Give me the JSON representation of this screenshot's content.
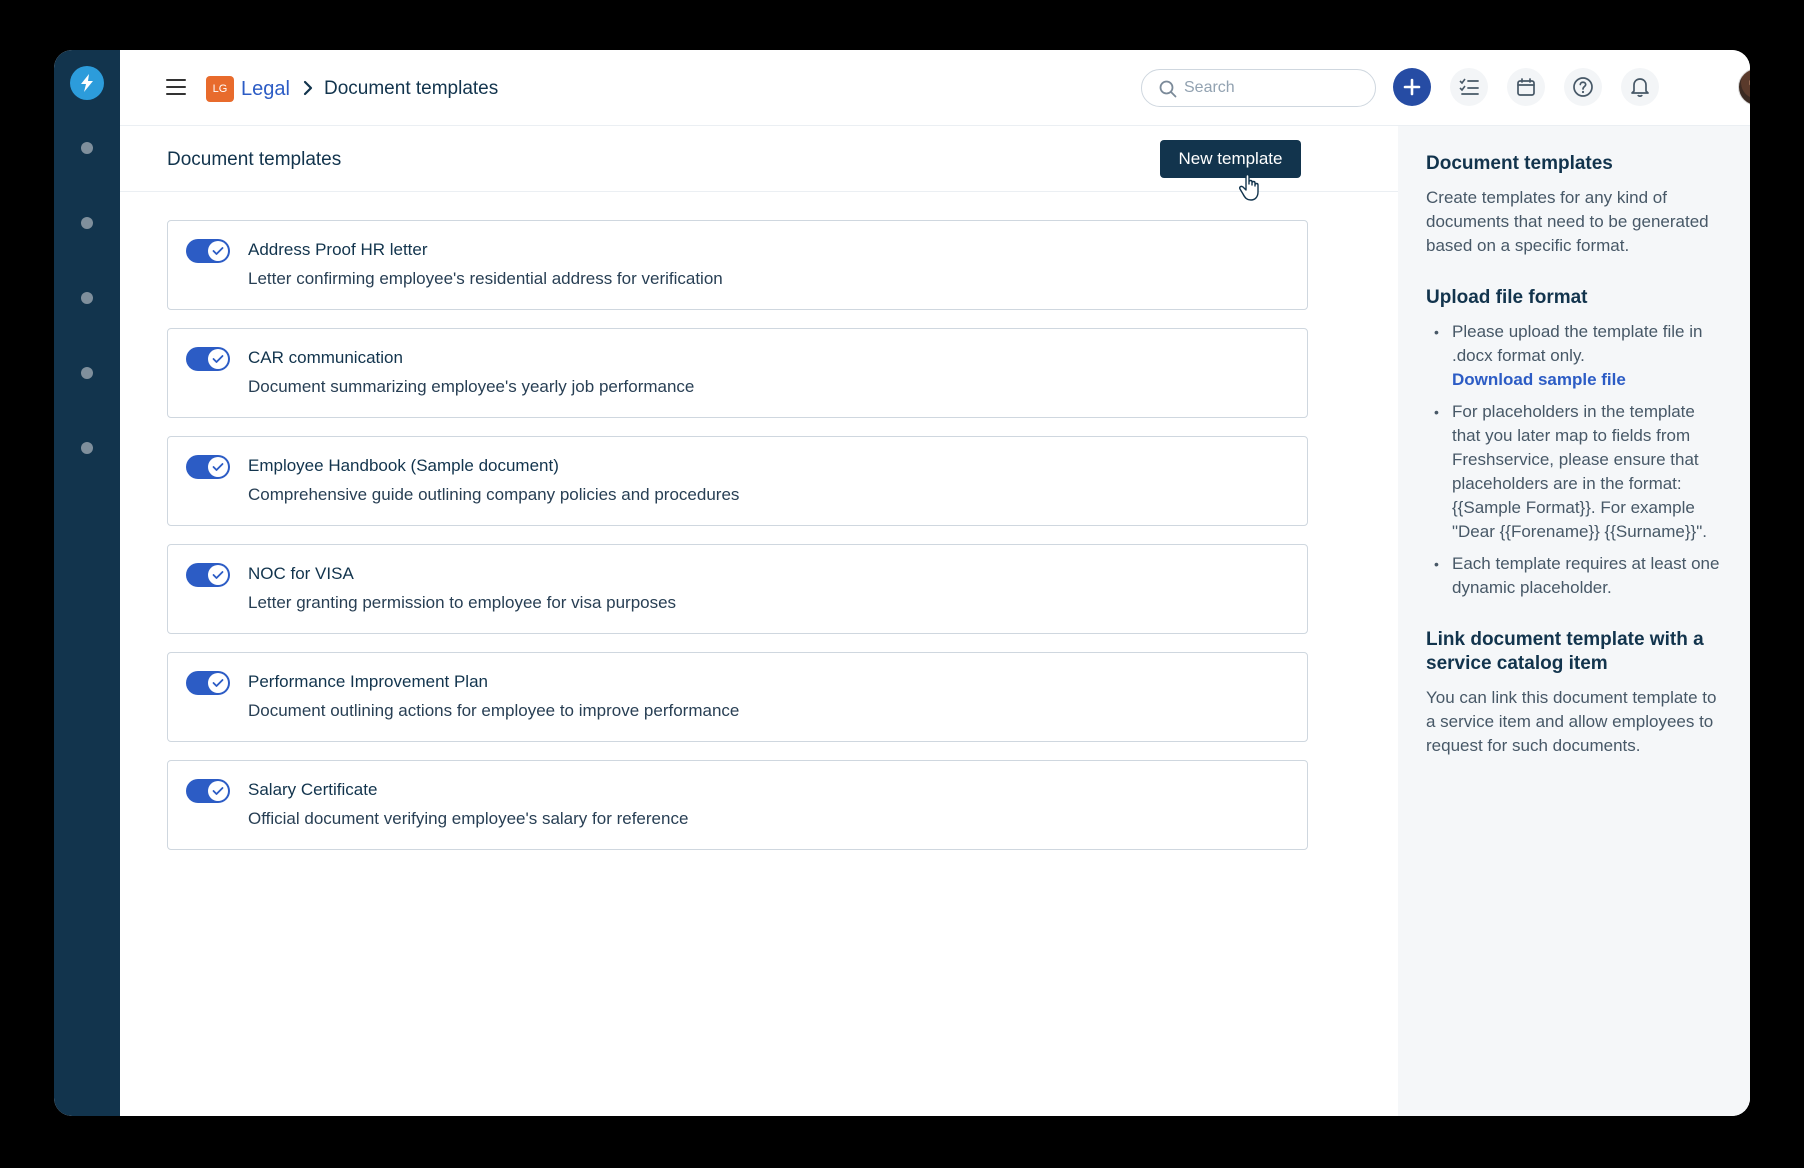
{
  "header": {
    "workspace_badge": "LG",
    "workspace_name": "Legal",
    "page_crumb": "Document templates",
    "search_placeholder": "Search",
    "brand_color": "#12344d",
    "accent_color": "#2c5cc5"
  },
  "content": {
    "title": "Document templates",
    "new_button": "New template"
  },
  "templates": [
    {
      "title": "Address Proof HR letter",
      "description": "Letter confirming employee's residential address for verification",
      "enabled": true
    },
    {
      "title": "CAR communication",
      "description": "Document summarizing employee's yearly job performance",
      "enabled": true
    },
    {
      "title": "Employee Handbook (Sample document)",
      "description": "Comprehensive guide outlining company policies and procedures",
      "enabled": true
    },
    {
      "title": "NOC for VISA",
      "description": "Letter granting permission to employee for visa purposes",
      "enabled": true
    },
    {
      "title": "Performance Improvement Plan",
      "description": "Document outlining actions for employee to improve performance",
      "enabled": true
    },
    {
      "title": "Salary Certificate",
      "description": "Official document verifying employee's salary for reference",
      "enabled": true
    }
  ],
  "sidebar": {
    "title": "Document templates",
    "intro": "Create templates for any kind of documents that need to be generated based on a specific format.",
    "upload_title": "Upload file format",
    "upload_bullet_1": "Please upload the template file in .docx format only.",
    "download_link": "Download sample file",
    "upload_bullet_2": "For placeholders in the template that you later map to fields from Freshservice, please ensure that placeholders are in the format: {{Sample Format}}. For example \"Dear {{Forename}} {{Surname}}\".",
    "upload_bullet_3": "Each template requires at least one dynamic placeholder.",
    "link_title": "Link document template with a service catalog item",
    "link_text": "You can link this document template to a service item and allow employees to request for such documents."
  },
  "icons": {
    "rail_logo": "bolt-icon",
    "menu": "hamburger-icon",
    "breadcrumb_separator": "chevron-right-icon",
    "search": "search-icon",
    "add": "plus-icon",
    "todo": "checklist-icon",
    "calendar": "calendar-icon",
    "help": "help-icon",
    "notifications": "bell-icon",
    "toggle_on": "check-icon"
  }
}
